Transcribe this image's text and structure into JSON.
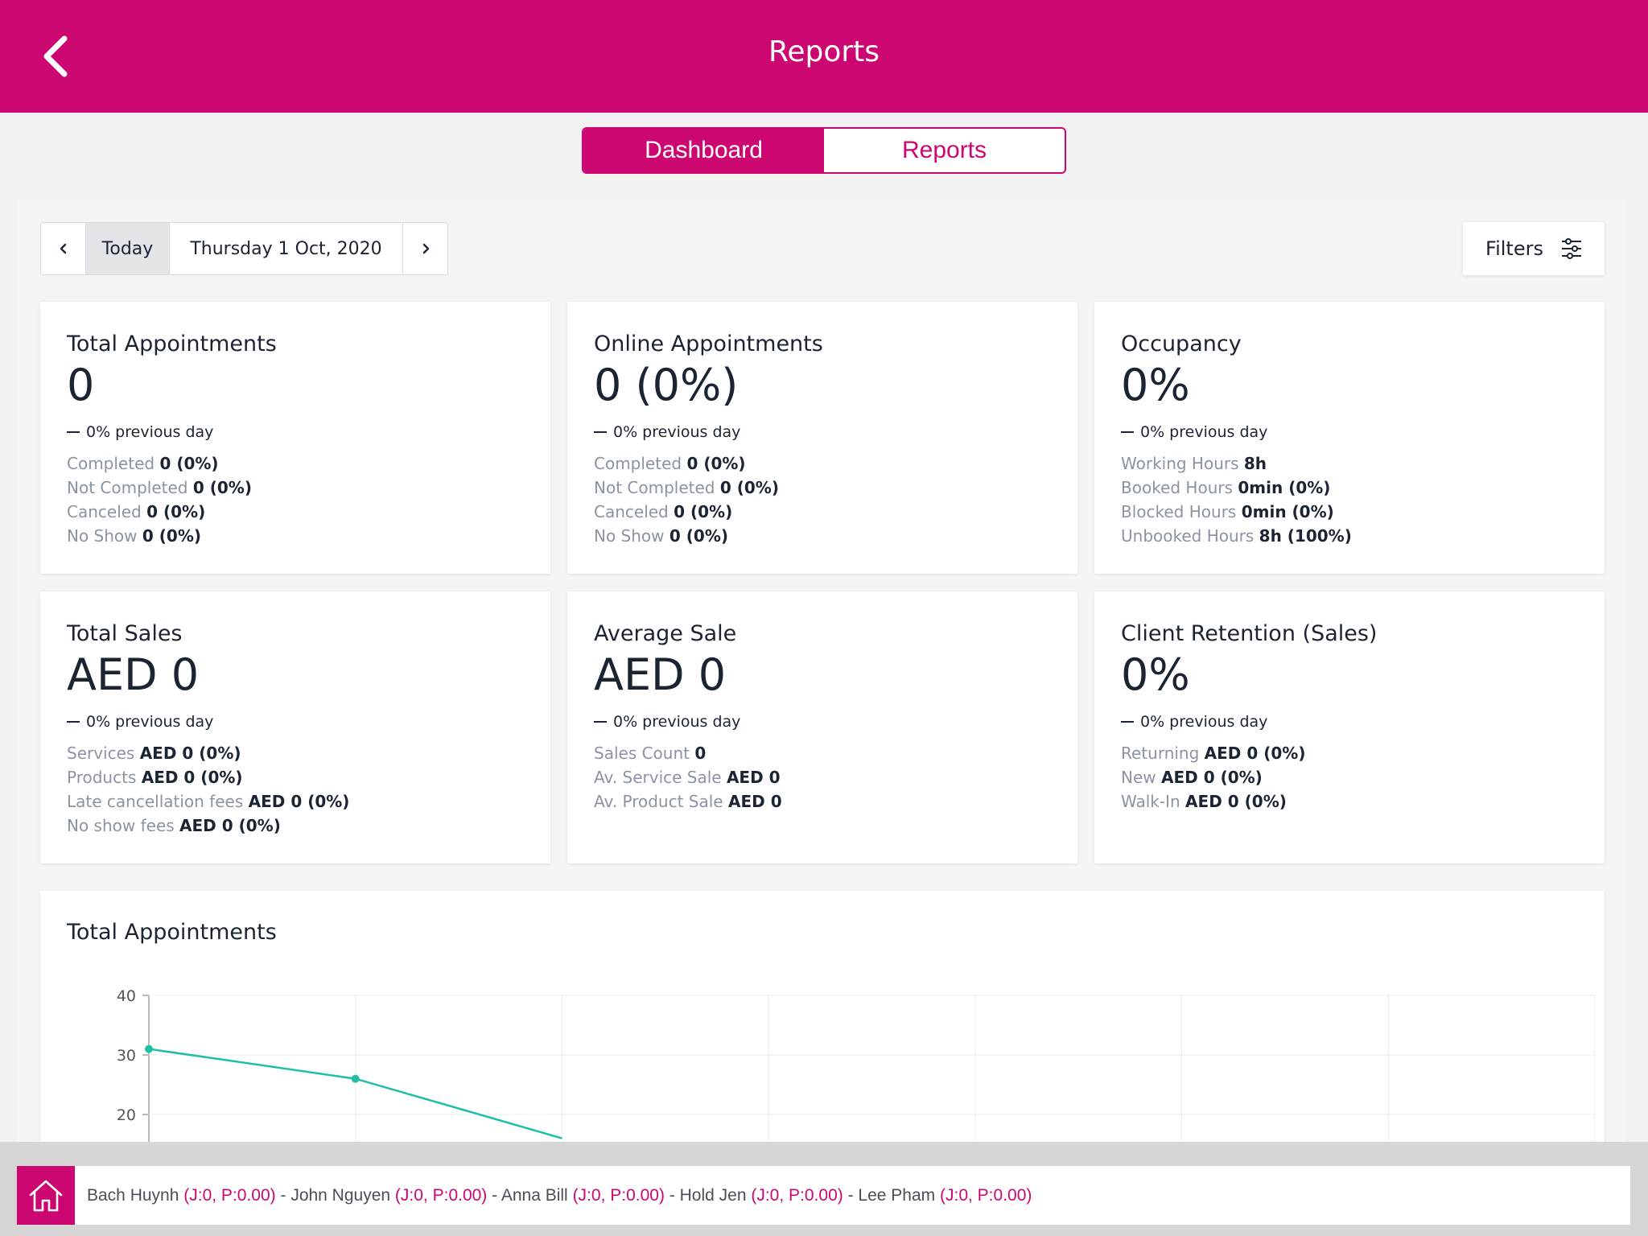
{
  "header": {
    "title": "Reports"
  },
  "segment": {
    "dashboard_label": "Dashboard",
    "reports_label": "Reports"
  },
  "date_nav": {
    "today_label": "Today",
    "date_label": "Thursday 1 Oct, 2020"
  },
  "filters": {
    "label": "Filters"
  },
  "cards": [
    {
      "title": "Total Appointments",
      "value": "0",
      "prev": "0% previous day",
      "lines": [
        {
          "label": "Completed",
          "value": "0 (0%)"
        },
        {
          "label": "Not Completed",
          "value": "0 (0%)"
        },
        {
          "label": "Canceled",
          "value": "0 (0%)"
        },
        {
          "label": "No Show",
          "value": "0 (0%)"
        }
      ]
    },
    {
      "title": "Online Appointments",
      "value": "0 (0%)",
      "prev": "0% previous day",
      "lines": [
        {
          "label": "Completed",
          "value": "0 (0%)"
        },
        {
          "label": "Not Completed",
          "value": "0 (0%)"
        },
        {
          "label": "Canceled",
          "value": "0 (0%)"
        },
        {
          "label": "No Show",
          "value": "0 (0%)"
        }
      ]
    },
    {
      "title": "Occupancy",
      "value": "0%",
      "prev": "0% previous day",
      "lines": [
        {
          "label": "Working Hours",
          "value": "8h"
        },
        {
          "label": "Booked Hours",
          "value": "0min (0%)"
        },
        {
          "label": "Blocked Hours",
          "value": "0min (0%)"
        },
        {
          "label": "Unbooked Hours",
          "value": "8h (100%)"
        }
      ]
    },
    {
      "title": "Total Sales",
      "value": "AED 0",
      "prev": "0% previous day",
      "lines": [
        {
          "label": "Services",
          "value": "AED 0 (0%)"
        },
        {
          "label": "Products",
          "value": "AED 0 (0%)"
        },
        {
          "label": "Late cancellation fees",
          "value": "AED 0 (0%)"
        },
        {
          "label": "No show fees",
          "value": "AED 0 (0%)"
        }
      ]
    },
    {
      "title": "Average Sale",
      "value": "AED 0",
      "prev": "0% previous day",
      "lines": [
        {
          "label": "Sales Count",
          "value": "0"
        },
        {
          "label": "Av. Service Sale",
          "value": "AED 0"
        },
        {
          "label": "Av. Product Sale",
          "value": "AED 0"
        }
      ]
    },
    {
      "title": "Client Retention (Sales)",
      "value": "0%",
      "prev": "0% previous day",
      "lines": [
        {
          "label": "Returning",
          "value": "AED 0 (0%)"
        },
        {
          "label": "New",
          "value": "AED 0 (0%)"
        },
        {
          "label": "Walk-In",
          "value": "AED 0 (0%)"
        }
      ]
    }
  ],
  "chart_card": {
    "title": "Total Appointments"
  },
  "chart_data": {
    "type": "line",
    "title": "Total Appointments",
    "y_ticks": [
      "40",
      "30",
      "20"
    ],
    "ylim": [
      10,
      40
    ],
    "series": [
      {
        "values": [
          31,
          26,
          16
        ]
      }
    ],
    "x_count": 8,
    "grid": true,
    "color": "#1fbfa6"
  },
  "staff_bar": {
    "entries": [
      {
        "name": "Bach Huynh",
        "stat": "(J:0, P:0.00)"
      },
      {
        "name": "John Nguyen",
        "stat": "(J:0, P:0.00)"
      },
      {
        "name": "Anna Bill",
        "stat": "(J:0, P:0.00)"
      },
      {
        "name": "Hold Jen",
        "stat": "(J:0, P:0.00)"
      },
      {
        "name": "Lee Pham",
        "stat": "(J:0, P:0.00)"
      }
    ],
    "separator": " - "
  },
  "colors": {
    "brand": "#cc0772",
    "chart_line": "#1fbfa6"
  }
}
